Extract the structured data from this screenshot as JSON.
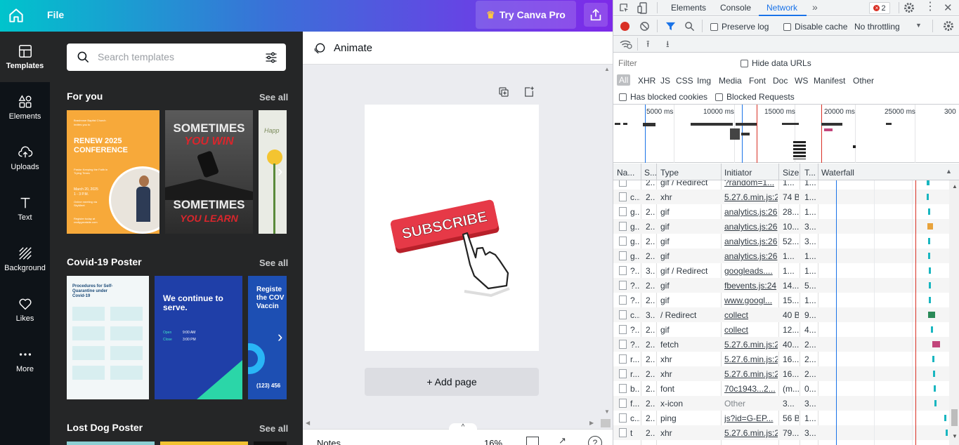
{
  "topbar": {
    "file_label": "File",
    "pro_label": "Try Canva Pro"
  },
  "rail": [
    {
      "label": "Templates",
      "icon": "templates-icon"
    },
    {
      "label": "Elements",
      "icon": "elements-icon"
    },
    {
      "label": "Uploads",
      "icon": "uploads-icon"
    },
    {
      "label": "Text",
      "icon": "text-icon"
    },
    {
      "label": "Background",
      "icon": "background-icon"
    },
    {
      "label": "Likes",
      "icon": "heart-icon"
    },
    {
      "label": "More",
      "icon": "more-icon"
    }
  ],
  "panel": {
    "search_placeholder": "Search templates",
    "sections": [
      {
        "title": "For you",
        "see_all": "See all"
      },
      {
        "title": "Covid-19 Poster",
        "see_all": "See all"
      },
      {
        "title": "Lost Dog Poster",
        "see_all": "See all"
      }
    ],
    "t1": {
      "church": "Brashrose Baptist Church",
      "invite": "invites you to",
      "title": "RENEW 2025 CONFERENCE",
      "sub": "Pastor Keeping the Faith in Trying Times",
      "date": "March 20, 2025",
      "time": "1 - 3 P.M.",
      "online": "Online meeting via SkyMeet",
      "register": "Register today at reallygreatsite.com"
    },
    "t2": {
      "line1": "SOMETIMES",
      "line2": "YOU WIN",
      "line3": "SOMETIMES",
      "line4": "YOU LEARN"
    },
    "t3": {
      "text": "Happ"
    },
    "t4": {
      "title": "Procedures for Self-Quarantine under Covid-19"
    },
    "t5": {
      "title": "We continue to serve.",
      "open_label": "Open",
      "open_time": "9:00 AM",
      "close_label": "Close",
      "close_time": "3:00 PM"
    },
    "t6": {
      "title": "Registe the COV Vaccin",
      "phone": "(123) 456"
    }
  },
  "editor": {
    "animate_label": "Animate",
    "subscribe_text": "SUBSCRIBE",
    "add_page_label": "+ Add page",
    "notes_label": "Notes",
    "zoom_label": "16%"
  },
  "devtools": {
    "tabs": [
      "Elements",
      "Console",
      "Network"
    ],
    "active_tab": "Network",
    "error_count": "2",
    "preserve_log": "Preserve log",
    "disable_cache": "Disable cache",
    "throttling": "No throttling",
    "filter_placeholder": "Filter",
    "hide_data_urls": "Hide data URLs",
    "types": [
      "All",
      "XHR",
      "JS",
      "CSS",
      "Img",
      "Media",
      "Font",
      "Doc",
      "WS",
      "Manifest",
      "Other"
    ],
    "has_blocked_cookies": "Has blocked cookies",
    "blocked_requests": "Blocked Requests",
    "overview_ticks": [
      "5000 ms",
      "10000 ms",
      "15000 ms",
      "20000 ms",
      "25000 ms",
      "300"
    ],
    "columns": [
      "Na...",
      "S...",
      "Type",
      "Initiator",
      "Size",
      "T...",
      "Waterfall"
    ],
    "rows": [
      {
        "name": "",
        "status": "2...",
        "type": "gif / Redirect",
        "initiator": "?random=1...",
        "size": "1...",
        "time": "1...",
        "wf": [
          0.83,
          0.02,
          "#19b6c0"
        ]
      },
      {
        "name": "c...",
        "status": "2...",
        "type": "xhr",
        "initiator": "5.27.6.min.js:2",
        "size": "74 B",
        "time": "1...",
        "wf": [
          0.83,
          0.015,
          "#19b6c0"
        ]
      },
      {
        "name": "g...",
        "status": "2...",
        "type": "gif",
        "initiator": "analytics.js:26",
        "size": "28...",
        "time": "1...",
        "wf": [
          0.84,
          0.015,
          "#19b6c0"
        ]
      },
      {
        "name": "g...",
        "status": "2...",
        "type": "gif",
        "initiator": "analytics.js:26",
        "size": "10...",
        "time": "3...",
        "wf": [
          0.835,
          0.04,
          "#e8a33c"
        ]
      },
      {
        "name": "g...",
        "status": "2...",
        "type": "gif",
        "initiator": "analytics.js:26",
        "size": "52...",
        "time": "3...",
        "wf": [
          0.84,
          0.015,
          "#19b6c0"
        ]
      },
      {
        "name": "g...",
        "status": "2...",
        "type": "gif",
        "initiator": "analytics.js:26",
        "size": "1...",
        "time": "1...",
        "wf": [
          0.84,
          0.015,
          "#19b6c0"
        ]
      },
      {
        "name": "?...",
        "status": "3...",
        "type": "gif / Redirect",
        "initiator": "googleads....",
        "size": "1...",
        "time": "1...",
        "wf": [
          0.845,
          0.015,
          "#19b6c0"
        ]
      },
      {
        "name": "?...",
        "status": "2...",
        "type": "gif",
        "initiator": "fbevents.js:24",
        "size": "14...",
        "time": "5...",
        "wf": [
          0.845,
          0.015,
          "#19b6c0"
        ]
      },
      {
        "name": "?...",
        "status": "2...",
        "type": "gif",
        "initiator": "www.googl...",
        "size": "15...",
        "time": "1...",
        "wf": [
          0.845,
          0.015,
          "#19b6c0"
        ]
      },
      {
        "name": "c...",
        "status": "3...",
        "type": "/ Redirect",
        "initiator": "collect",
        "size": "40 B",
        "time": "9...",
        "wf": [
          0.84,
          0.05,
          "#2a8a58"
        ]
      },
      {
        "name": "?...",
        "status": "2...",
        "type": "gif",
        "initiator": "collect",
        "size": "12...",
        "time": "4...",
        "wf": [
          0.86,
          0.015,
          "#19b6c0"
        ]
      },
      {
        "name": "?...",
        "status": "2...",
        "type": "fetch",
        "initiator": "5.27.6.min.js:2",
        "size": "40...",
        "time": "2...",
        "wf": [
          0.87,
          0.06,
          "#c2457b"
        ]
      },
      {
        "name": "r...",
        "status": "2...",
        "type": "xhr",
        "initiator": "5.27.6.min.js:2",
        "size": "16...",
        "time": "2...",
        "wf": [
          0.87,
          0.015,
          "#19b6c0"
        ]
      },
      {
        "name": "r...",
        "status": "2...",
        "type": "xhr",
        "initiator": "5.27.6.min.js:2",
        "size": "16...",
        "time": "2...",
        "wf": [
          0.875,
          0.015,
          "#19b6c0"
        ]
      },
      {
        "name": "b...",
        "status": "2...",
        "type": "font",
        "initiator": "70c1943...2...",
        "size": "(m...",
        "time": "0...",
        "wf": [
          0.88,
          0.015,
          "#19b6c0"
        ]
      },
      {
        "name": "f...",
        "status": "2...",
        "type": "x-icon",
        "initiator": "Other",
        "size": "3...",
        "time": "3...",
        "wf": [
          0.885,
          0.015,
          "#19b6c0"
        ]
      },
      {
        "name": "c...",
        "status": "2...",
        "type": "ping",
        "initiator": "js?id=G-EP...",
        "size": "56 B",
        "time": "1...",
        "wf": [
          0.96,
          0.015,
          "#19b6c0"
        ]
      },
      {
        "name": "t",
        "status": "2...",
        "type": "xhr",
        "initiator": "5.27.6.min.js:2",
        "size": "79...",
        "time": "3...",
        "wf": [
          0.975,
          0.015,
          "#19b6c0"
        ]
      }
    ]
  }
}
